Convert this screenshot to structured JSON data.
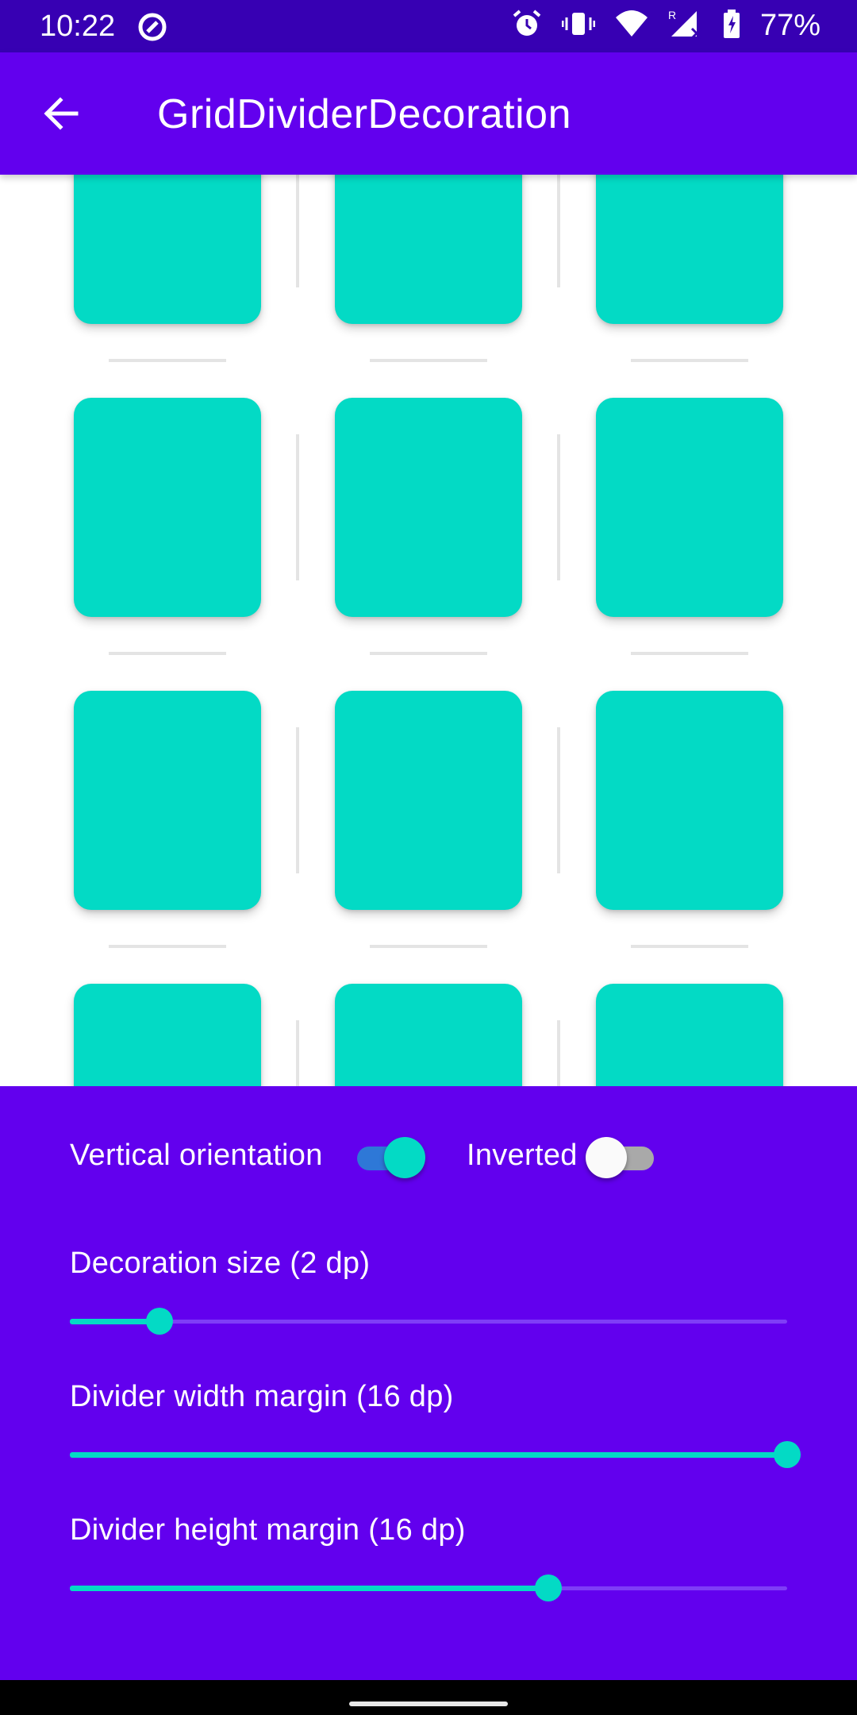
{
  "status_bar": {
    "time": "10:22",
    "battery_percent": "77%",
    "icons": [
      "sync-icon",
      "alarm-icon",
      "vibrate-icon",
      "wifi-icon",
      "signal-roaming-icon",
      "battery-charging-icon"
    ]
  },
  "app_bar": {
    "back_icon": "arrow-back-icon",
    "title": "GridDividerDecoration"
  },
  "grid": {
    "columns": 3,
    "visible_rows": 4,
    "item_color": "#03dac5",
    "divider_color": "#e4e4e4"
  },
  "controls": {
    "vertical_orientation": {
      "label": "Vertical orientation",
      "checked": true
    },
    "inverted": {
      "label": "Inverted",
      "checked": false
    },
    "decoration_size": {
      "label": "Decoration size (2 dp)",
      "value_fraction": 0.125
    },
    "divider_width_margin": {
      "label": "Divider width margin (16 dp)",
      "value_fraction": 1.0
    },
    "divider_height_margin": {
      "label": "Divider height margin (16 dp)",
      "value_fraction": 0.667
    }
  },
  "colors": {
    "primary": "#6200ee",
    "primary_dark": "#3700b3",
    "accent": "#03dac5"
  }
}
